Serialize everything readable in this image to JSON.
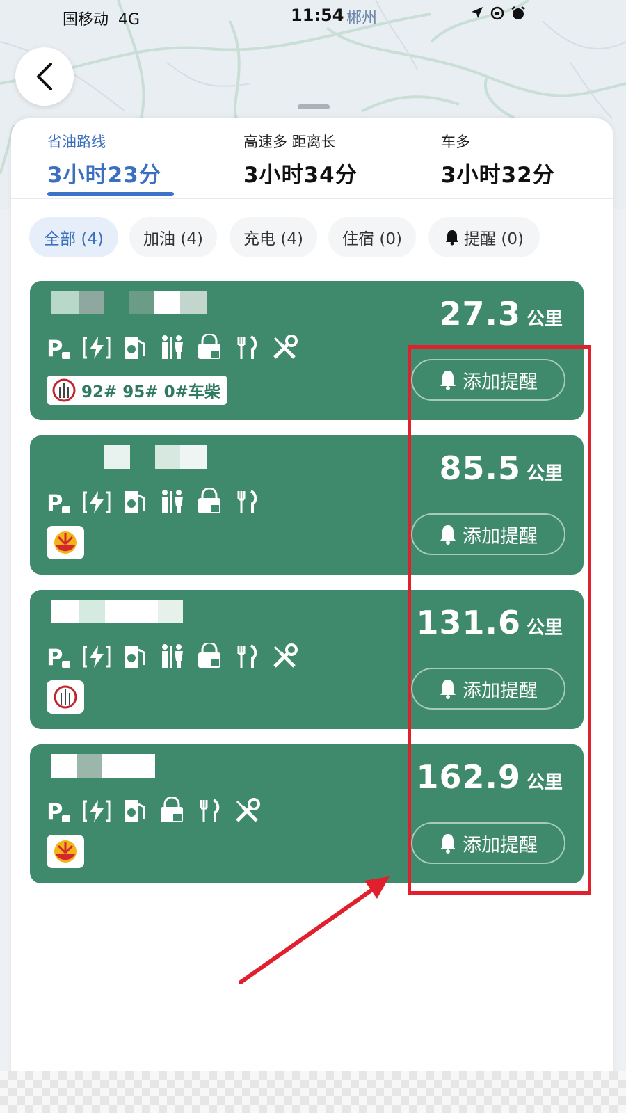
{
  "status_bar": {
    "carrier": "国移动",
    "network": "4G",
    "time": "11:54",
    "city": "郴州",
    "icons": [
      "location-arrow-icon",
      "rotation-lock-icon",
      "alarm-icon"
    ]
  },
  "route_tabs": [
    {
      "label": "省油路线",
      "time": "3小时23分",
      "active": true
    },
    {
      "label": "高速多 距离长",
      "time": "3小时34分",
      "active": false
    },
    {
      "label": "车多",
      "time": "3小时32分",
      "active": false
    }
  ],
  "filters": [
    {
      "label": "全部 (4)",
      "active": true
    },
    {
      "label": "加油 (4)",
      "active": false
    },
    {
      "label": "充电 (4)",
      "active": false
    },
    {
      "label": "住宿 (0)",
      "active": false
    },
    {
      "label": "提醒 (0)",
      "active": false,
      "icon": "bell-icon"
    }
  ],
  "stations": [
    {
      "distance": "27.3",
      "unit": "公里",
      "amenities": [
        "parking-icon",
        "charging-icon",
        "fuel-pump-icon",
        "restroom-icon",
        "store-icon",
        "restaurant-icon",
        "repair-icon"
      ],
      "brand": "sinopec-logo",
      "fuels": "92# 95# 0#车柴",
      "remind_label": "添加提醒"
    },
    {
      "distance": "85.5",
      "unit": "公里",
      "amenities": [
        "parking-icon",
        "charging-icon",
        "fuel-pump-icon",
        "restroom-icon",
        "store-icon",
        "restaurant-icon"
      ],
      "brand": "petrochina-logo",
      "remind_label": "添加提醒"
    },
    {
      "distance": "131.6",
      "unit": "公里",
      "amenities": [
        "parking-icon",
        "charging-icon",
        "fuel-pump-icon",
        "restroom-icon",
        "store-icon",
        "restaurant-icon",
        "repair-icon"
      ],
      "brand": "sinopec-logo",
      "remind_label": "添加提醒"
    },
    {
      "distance": "162.9",
      "unit": "公里",
      "amenities": [
        "parking-icon",
        "charging-icon",
        "fuel-pump-icon",
        "store-icon",
        "restaurant-icon",
        "repair-icon"
      ],
      "brand": "petrochina-logo",
      "remind_label": "添加提醒"
    }
  ],
  "colors": {
    "accent": "#3b6fbf",
    "card_green": "#3f896c",
    "annotation_red": "#e0202c"
  }
}
